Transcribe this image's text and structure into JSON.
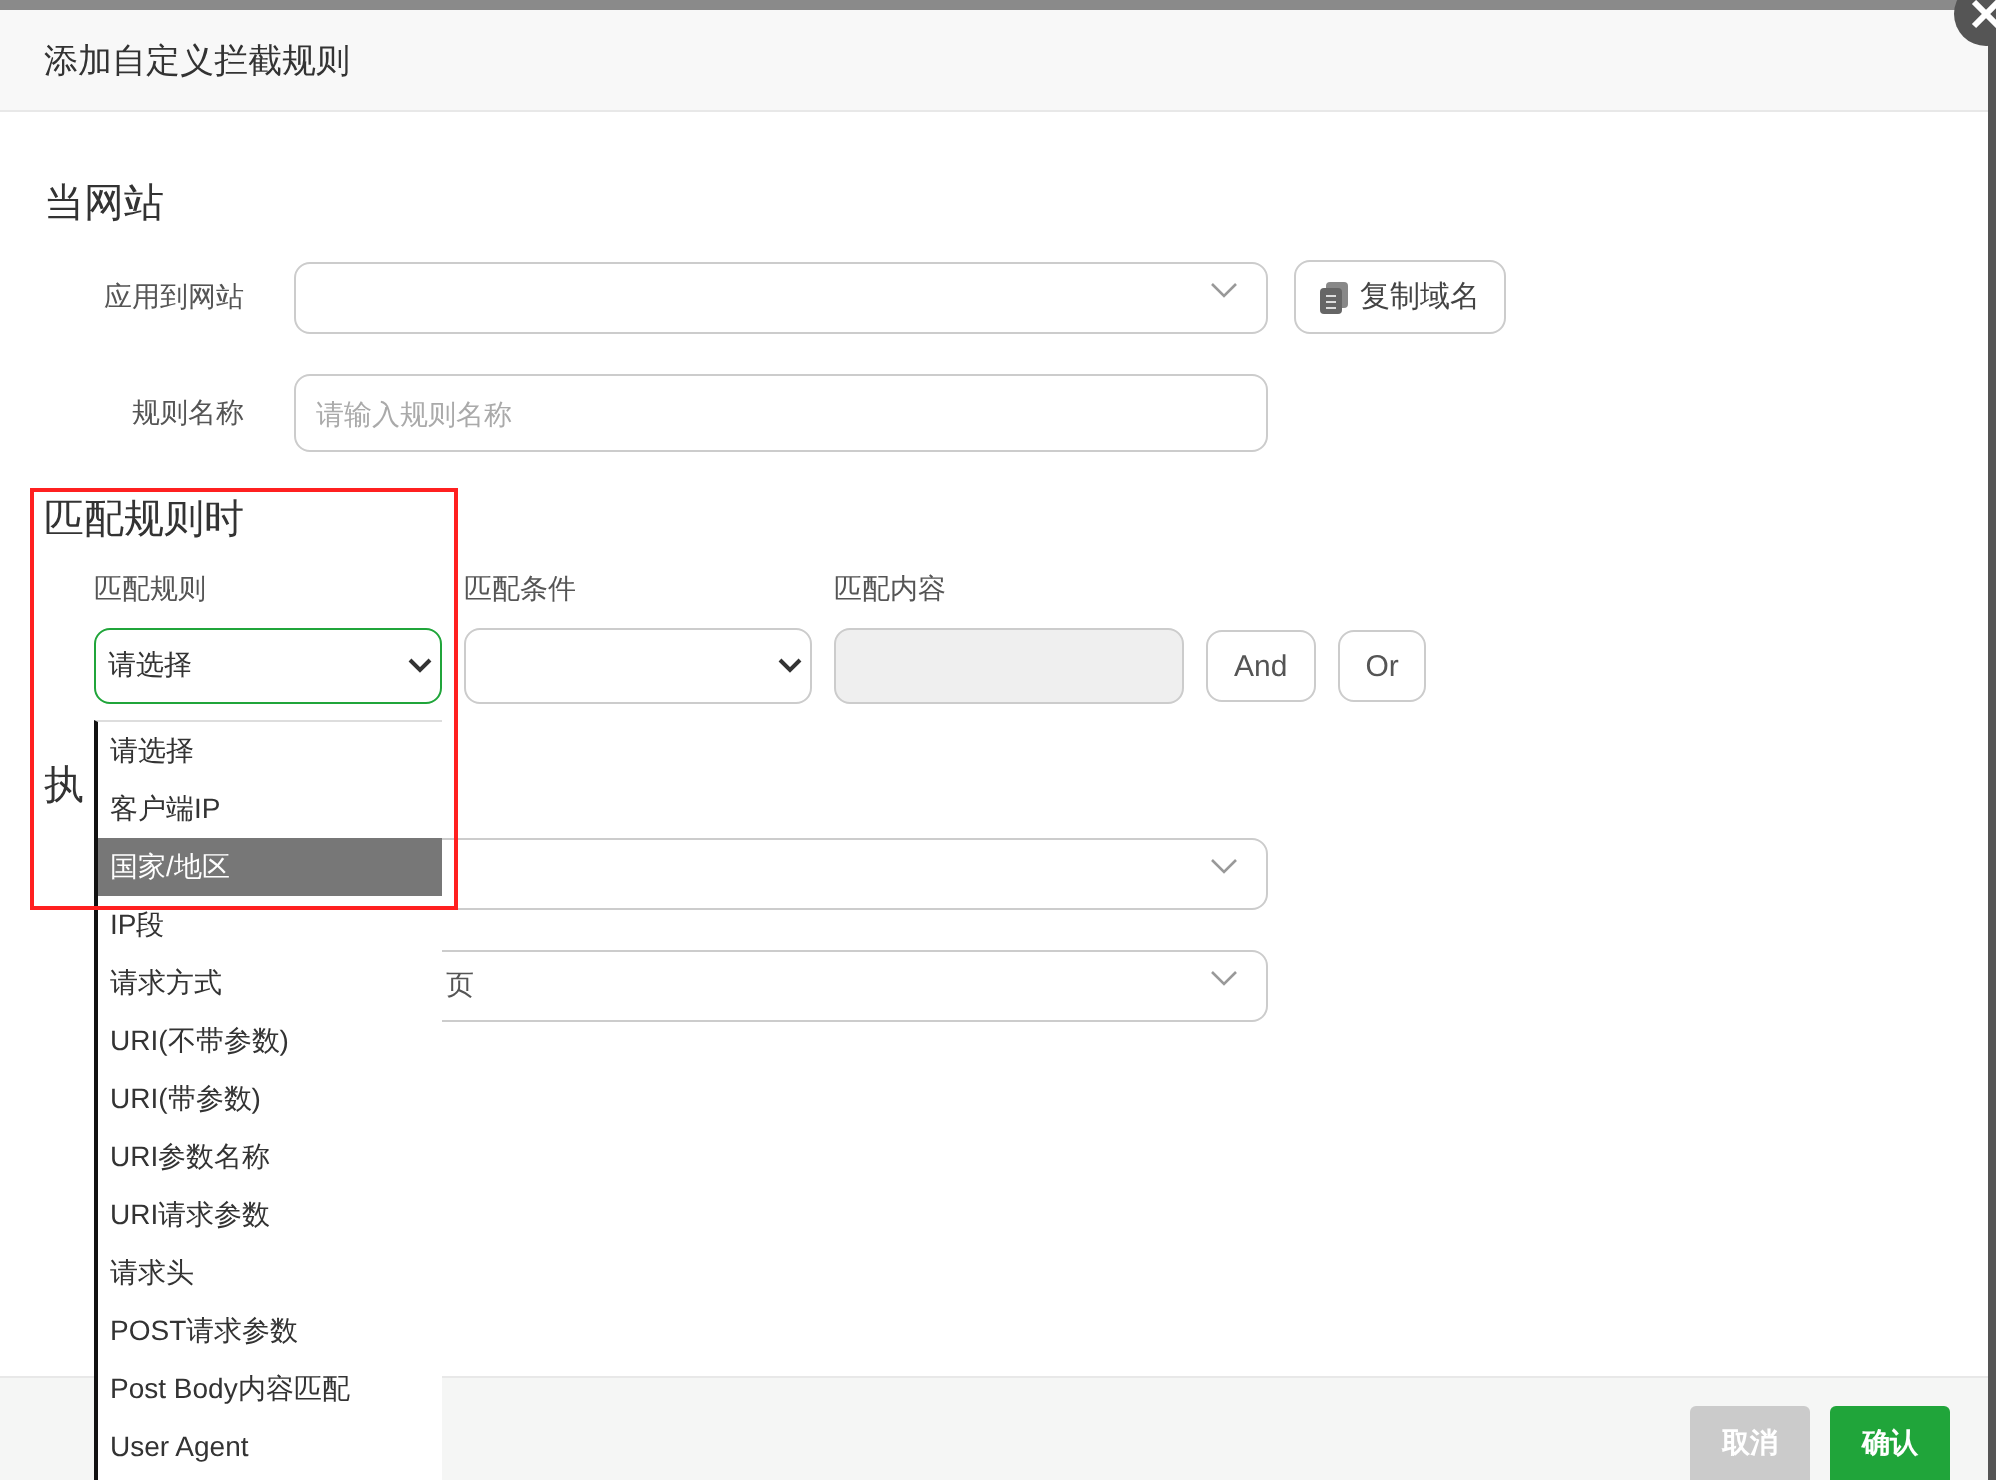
{
  "dialog": {
    "title": "添加自定义拦截规则"
  },
  "site_section": {
    "heading": "当网站",
    "fields": [
      {
        "kind": "select",
        "label": "应用到网站"
      },
      {
        "kind": "input",
        "label": "规则名称",
        "placeholder": "请输入规则名称"
      }
    ],
    "copy_button": "复制域名"
  },
  "match_section": {
    "heading": "匹配规则时",
    "columns": [
      "匹配规则",
      "匹配条件",
      "匹配内容"
    ],
    "rule_select": {
      "value": "请选择",
      "focused": true
    },
    "content_input": {
      "disabled": true
    },
    "buttons": [
      "And",
      "Or"
    ]
  },
  "action_section": {
    "heading": "执",
    "selects": [
      {
        "kind": "empty"
      },
      {
        "kind": "filled",
        "value": "页"
      }
    ]
  },
  "dropdown": {
    "options": [
      {
        "label": "请选择",
        "selected": false
      },
      {
        "label": "客户端IP",
        "selected": false
      },
      {
        "label": "国家/地区",
        "selected": true
      },
      {
        "label": "IP段",
        "selected": false
      },
      {
        "label": "请求方式",
        "selected": false
      },
      {
        "label": "URI(不带参数)",
        "selected": false
      },
      {
        "label": "URI(带参数)",
        "selected": false
      },
      {
        "label": "URI参数名称",
        "selected": false
      },
      {
        "label": "URI请求参数",
        "selected": false
      },
      {
        "label": "请求头",
        "selected": false
      },
      {
        "label": "POST请求参数",
        "selected": false
      },
      {
        "label": "Post Body内容匹配",
        "selected": false
      },
      {
        "label": "User Agent",
        "selected": false
      }
    ]
  },
  "footer": {
    "buttons": [
      {
        "label": "取消",
        "kind": "cancel"
      },
      {
        "label": "确认",
        "kind": "primary"
      }
    ]
  }
}
